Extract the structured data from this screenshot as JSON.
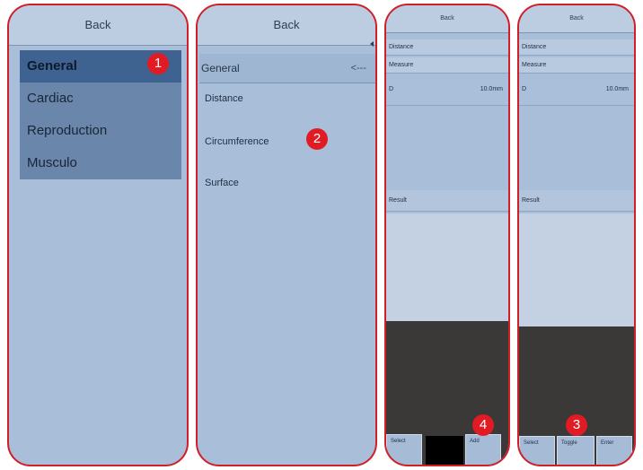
{
  "panel1": {
    "header": "Back",
    "menu": [
      "General",
      "Cardiac",
      "Reproduction",
      "Musculo"
    ]
  },
  "panel2": {
    "header": "Back",
    "subheader": "General",
    "back_arrow": "<---",
    "items": [
      "Distance",
      "Circumference",
      "Surface"
    ]
  },
  "panel3": {
    "header": "Back",
    "distance": "Distance",
    "measure": "Measure",
    "d_label": "D",
    "d_value": "10.0mm",
    "result": "Result",
    "btn_select": "Select",
    "btn_add": "Add"
  },
  "panel4": {
    "header": "Back",
    "distance": "Distance",
    "measure": "Measure",
    "d_label": "D",
    "d_value": "10.0mm",
    "result": "Result",
    "btn_select": "Select",
    "btn_toggle": "Toggle",
    "btn_enter": "Enter"
  },
  "badges": [
    "1",
    "2",
    "3",
    "4"
  ]
}
